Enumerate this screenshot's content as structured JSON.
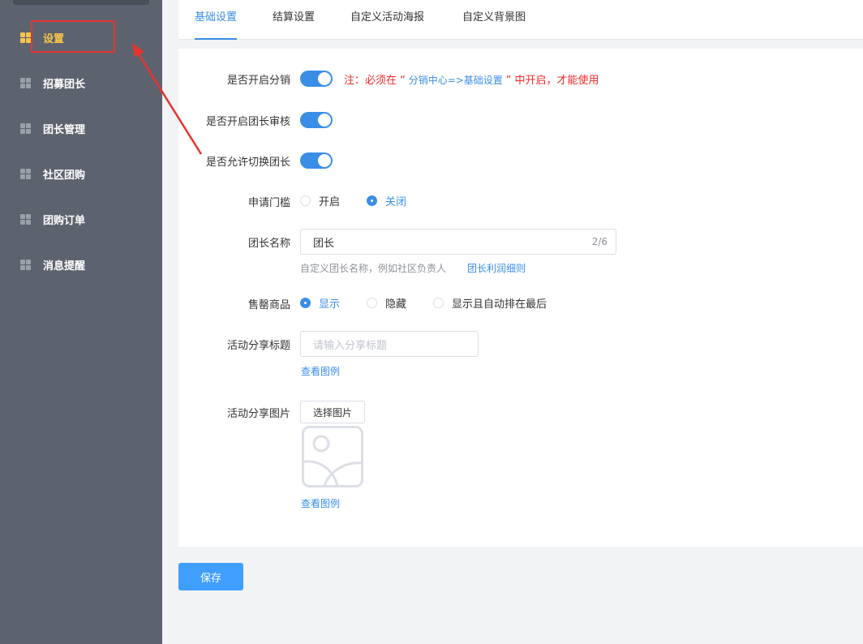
{
  "sidebar": {
    "items": [
      {
        "label": "设置",
        "active": true
      },
      {
        "label": "招募团长",
        "active": false
      },
      {
        "label": "团长管理",
        "active": false
      },
      {
        "label": "社区团购",
        "active": false
      },
      {
        "label": "团购订单",
        "active": false
      },
      {
        "label": "消息提醒",
        "active": false
      }
    ]
  },
  "tabs": [
    {
      "label": "基础设置",
      "active": true
    },
    {
      "label": "结算设置",
      "active": false
    },
    {
      "label": "自定义活动海报",
      "active": false
    },
    {
      "label": "自定义背景图",
      "active": false
    }
  ],
  "form": {
    "enable_distribution": {
      "label": "是否开启分销",
      "on": true,
      "note_prefix": "注：必须在 “",
      "note_link": " 分销中心=>基础设置 ",
      "note_suffix": "” 中开启，才能使用"
    },
    "enable_leader_review": {
      "label": "是否开启团长审核",
      "on": true
    },
    "allow_switch_leader": {
      "label": "是否允许切换团长",
      "on": true
    },
    "apply_threshold": {
      "label": "申请门槛",
      "options": [
        "开启",
        "关闭"
      ],
      "selected": "关闭"
    },
    "leader_name": {
      "label": "团长名称",
      "value": "团长",
      "count": "2/6",
      "hint": "自定义团长名称，例如社区负责人",
      "hint_link": "团长利润细则"
    },
    "sold_out_goods": {
      "label": "售罄商品",
      "options": [
        "显示",
        "隐藏",
        "显示且自动排在最后"
      ],
      "selected": "显示"
    },
    "share_title": {
      "label": "活动分享标题",
      "placeholder": "请输入分享标题",
      "example_link": "查看图例"
    },
    "share_image": {
      "label": "活动分享图片",
      "button": "选择图片",
      "example_link": "查看图例"
    }
  },
  "actions": {
    "save_label": "保存"
  },
  "colors": {
    "accent": "#3a8ee6",
    "sidebar_bg": "#5d636e",
    "sidebar_active": "#f7c64a",
    "warning": "#ee2b2b",
    "annotation": "#e8332f"
  }
}
